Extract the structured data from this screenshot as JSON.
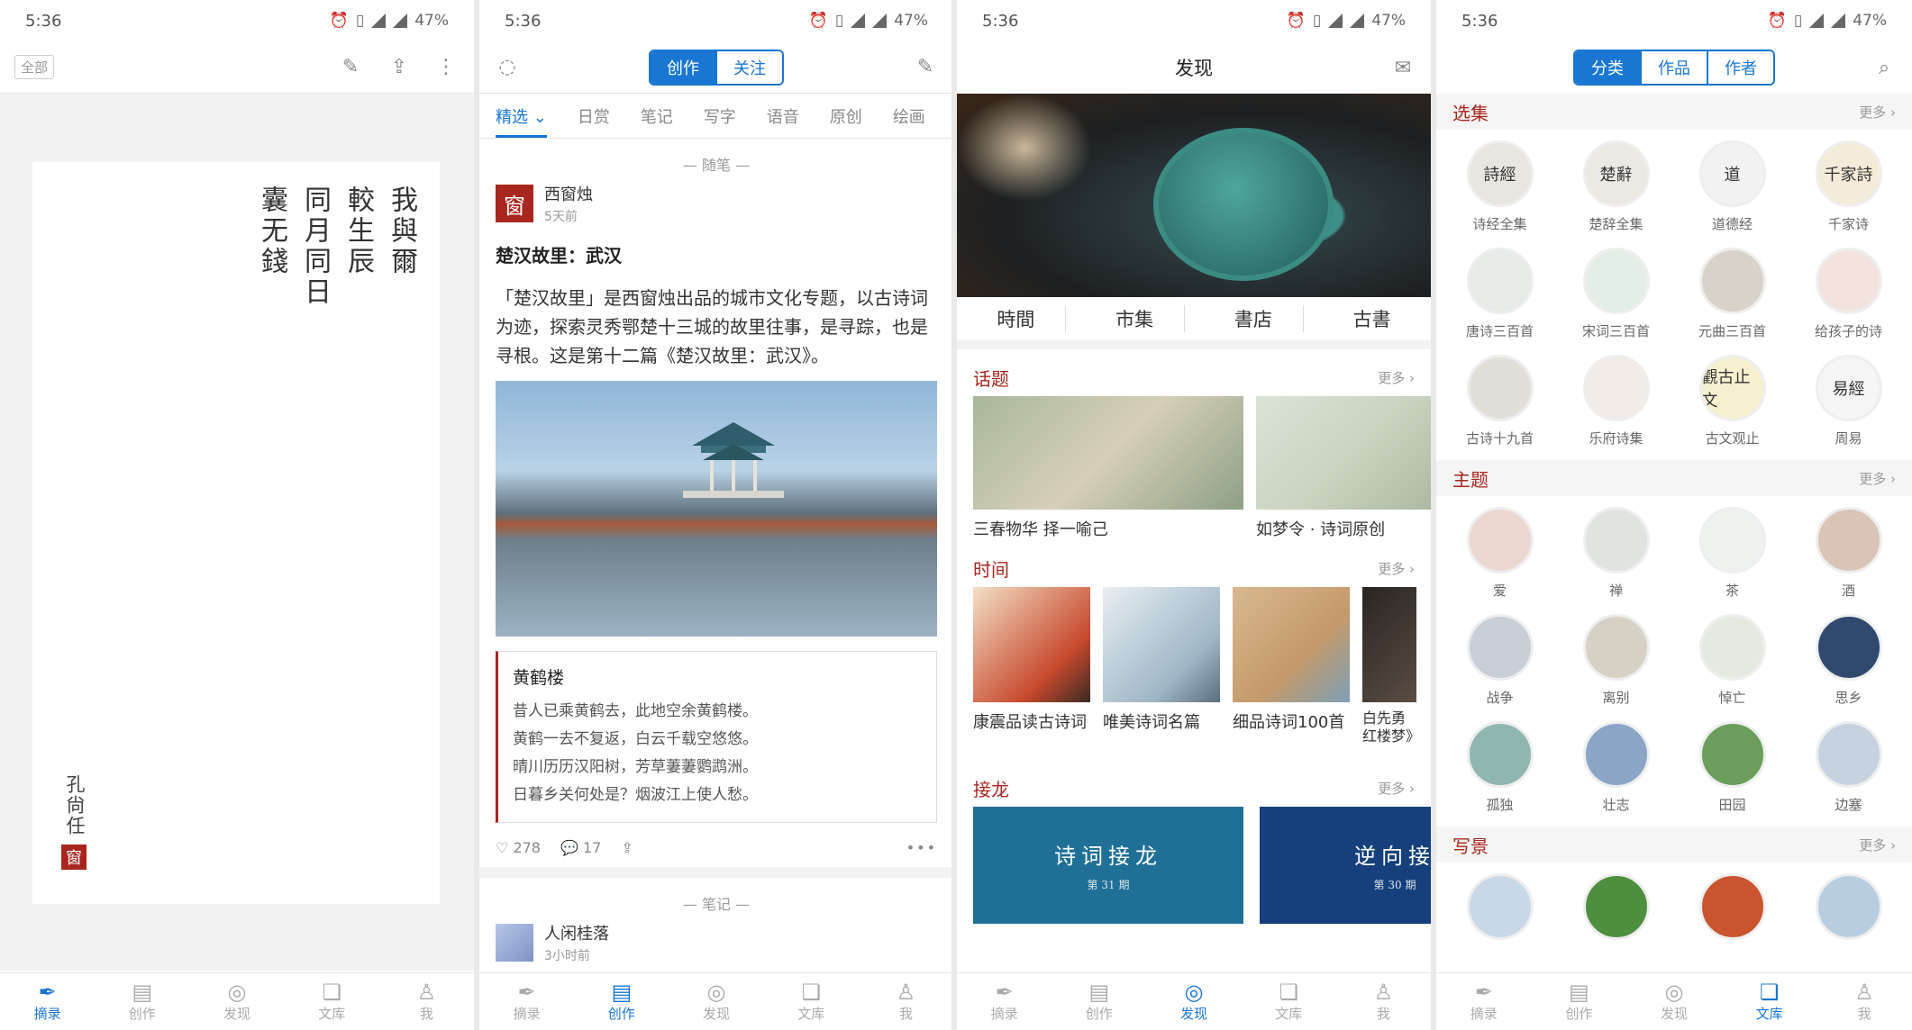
{
  "status": {
    "time": "5:36",
    "battery": "47%"
  },
  "colors": {
    "accent": "#1976d2",
    "seal_red": "#a8261e"
  },
  "nav": {
    "items": [
      "摘录",
      "创作",
      "发现",
      "文库",
      "我"
    ]
  },
  "screen1": {
    "tag": "全部",
    "poem_columns": [
      "我與爾",
      "較生辰",
      "同月同日",
      "囊无錢"
    ],
    "author": "孔尙任",
    "seal": "窗"
  },
  "screen2": {
    "seg": [
      "创作",
      "关注"
    ],
    "tabs": [
      "精选",
      "日赏",
      "笔记",
      "写字",
      "语音",
      "原创",
      "绘画"
    ],
    "section1": "随笔",
    "author": {
      "name": "西窗烛",
      "time": "5天前",
      "seal": "窗"
    },
    "post_title": "楚汉故里：武汉",
    "post_body": "「楚汉故里」是西窗烛出品的城市文化专题，以古诗词为迹，探索灵秀鄂楚十三城的故里往事，是寻踪，也是寻根。这是第十二篇《楚汉故里：武汉》。",
    "quote": {
      "title": "黄鹤楼",
      "lines": [
        "昔人已乘黄鹤去，此地空余黄鹤楼。",
        "黄鹤一去不复返，白云千载空悠悠。",
        "晴川历历汉阳树，芳草萋萋鹦鹉洲。",
        "日暮乡关何处是？烟波江上使人愁。"
      ]
    },
    "likes": "278",
    "comments": "17",
    "section2": "笔记",
    "author2": {
      "name": "人闲桂落",
      "time": "3小时前"
    }
  },
  "screen3": {
    "title": "发现",
    "cats": [
      "時間",
      "市集",
      "書店",
      "古書"
    ],
    "more": "更多",
    "topics_head": "话题",
    "topics": [
      "三春物华 择一喻己",
      "如梦令 · 诗词原创"
    ],
    "time_head": "时间",
    "times": [
      "康震品读古诗词",
      "唯美诗词名篇",
      "细品诗词100首",
      "白先勇红楼梦》"
    ],
    "jielong_head": "接龙",
    "jielong": [
      {
        "title": "诗词接龙",
        "issue": "第 31 期"
      },
      {
        "title": "逆向接",
        "issue": "第 30 期"
      }
    ]
  },
  "screen4": {
    "seg": [
      "分类",
      "作品",
      "作者"
    ],
    "more": "更多",
    "sections": [
      {
        "title": "选集",
        "items": [
          {
            "label": "诗经全集",
            "glyph": "詩經"
          },
          {
            "label": "楚辞全集",
            "glyph": "楚辭"
          },
          {
            "label": "道德经",
            "glyph": "道"
          },
          {
            "label": "千家诗",
            "glyph": "千家詩"
          },
          {
            "label": "唐诗三百首",
            "glyph": ""
          },
          {
            "label": "宋词三百首",
            "glyph": ""
          },
          {
            "label": "元曲三百首",
            "glyph": ""
          },
          {
            "label": "给孩子的诗",
            "glyph": ""
          },
          {
            "label": "古诗十九首",
            "glyph": ""
          },
          {
            "label": "乐府诗集",
            "glyph": ""
          },
          {
            "label": "古文观止",
            "glyph": "觀古止文"
          },
          {
            "label": "周易",
            "glyph": "易經"
          }
        ]
      },
      {
        "title": "主题",
        "items": [
          {
            "label": "爱",
            "glyph": ""
          },
          {
            "label": "禅",
            "glyph": ""
          },
          {
            "label": "茶",
            "glyph": ""
          },
          {
            "label": "酒",
            "glyph": ""
          },
          {
            "label": "战争",
            "glyph": ""
          },
          {
            "label": "离别",
            "glyph": ""
          },
          {
            "label": "悼亡",
            "glyph": ""
          },
          {
            "label": "思乡",
            "glyph": ""
          },
          {
            "label": "孤独",
            "glyph": ""
          },
          {
            "label": "壮志",
            "glyph": ""
          },
          {
            "label": "田园",
            "glyph": ""
          },
          {
            "label": "边塞",
            "glyph": ""
          }
        ]
      },
      {
        "title": "写景",
        "items": [
          {
            "label": "",
            "glyph": ""
          },
          {
            "label": "",
            "glyph": ""
          },
          {
            "label": "",
            "glyph": ""
          },
          {
            "label": "",
            "glyph": ""
          }
        ]
      }
    ]
  }
}
